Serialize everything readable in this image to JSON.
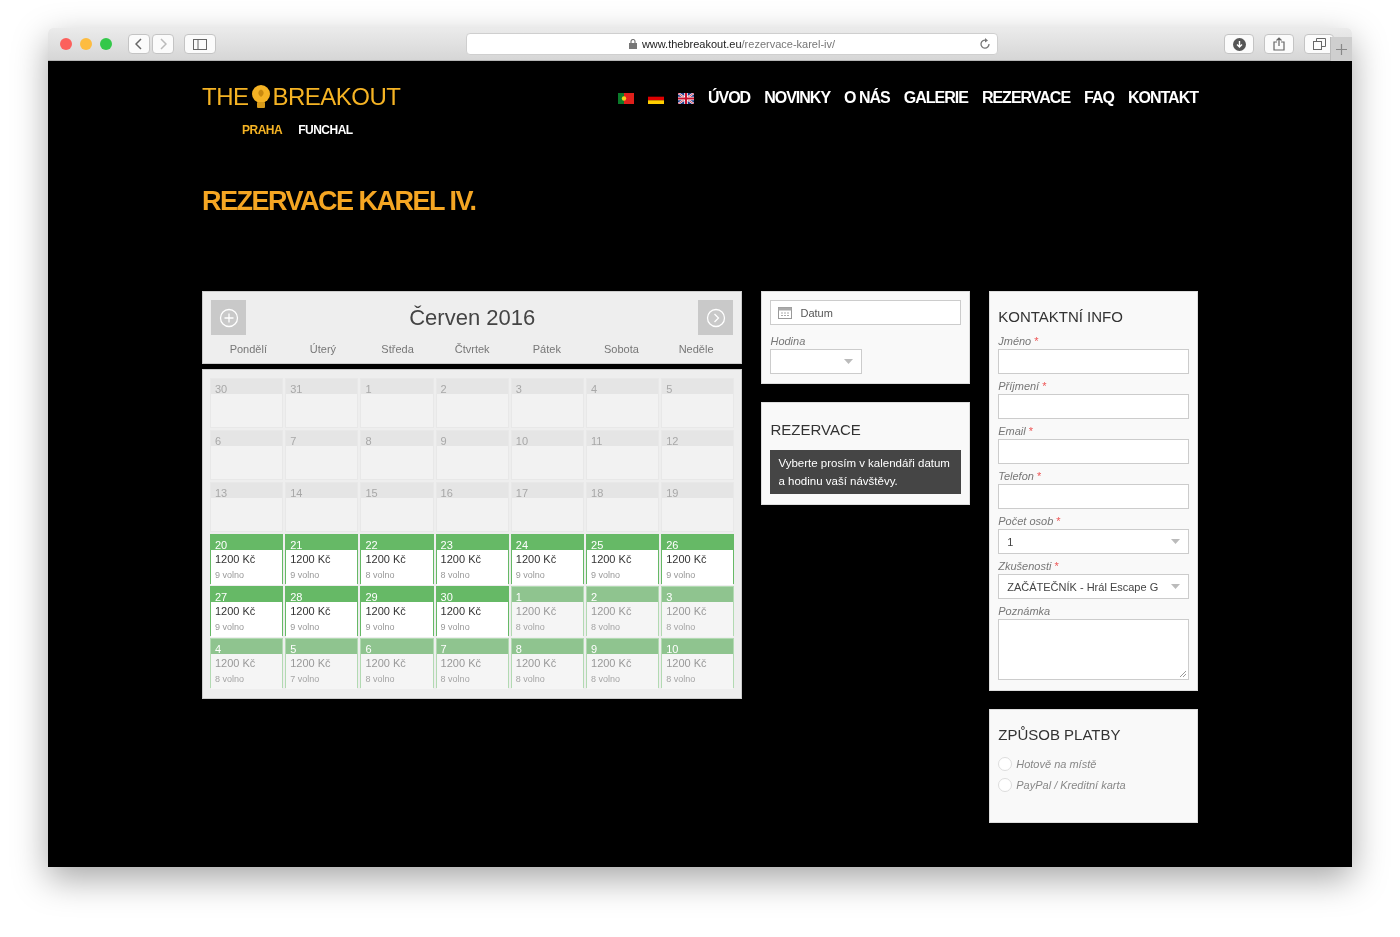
{
  "browser": {
    "url_domain": "www.thebreakout.eu",
    "url_path": "/rezervace-karel-iv/"
  },
  "logo": {
    "word_1": "THE",
    "word_2": "BREAKOUT"
  },
  "cities": [
    {
      "label": "PRAHA",
      "selected": true
    },
    {
      "label": "FUNCHAL",
      "selected": false
    }
  ],
  "nav": [
    "ÚVOD",
    "NOVINKY",
    "O NÁS",
    "GALERIE",
    "REZERVACE",
    "FAQ",
    "KONTAKT"
  ],
  "page_title": "REZERVACE KAREL IV.",
  "calendar": {
    "month": "Červen 2016",
    "weekdays": [
      "Pondělí",
      "Úterý",
      "Středa",
      "Čtvrtek",
      "Pátek",
      "Sobota",
      "Neděle"
    ],
    "weeks": [
      [
        {
          "day": "30",
          "kind": "past"
        },
        {
          "day": "31",
          "kind": "past"
        },
        {
          "day": "1",
          "kind": "past"
        },
        {
          "day": "2",
          "kind": "past"
        },
        {
          "day": "3",
          "kind": "past"
        },
        {
          "day": "4",
          "kind": "past"
        },
        {
          "day": "5",
          "kind": "past"
        }
      ],
      [
        {
          "day": "6",
          "kind": "past"
        },
        {
          "day": "7",
          "kind": "past"
        },
        {
          "day": "8",
          "kind": "past"
        },
        {
          "day": "9",
          "kind": "past"
        },
        {
          "day": "10",
          "kind": "past"
        },
        {
          "day": "11",
          "kind": "past"
        },
        {
          "day": "12",
          "kind": "past"
        }
      ],
      [
        {
          "day": "13",
          "kind": "past"
        },
        {
          "day": "14",
          "kind": "past"
        },
        {
          "day": "15",
          "kind": "past"
        },
        {
          "day": "16",
          "kind": "past"
        },
        {
          "day": "17",
          "kind": "past"
        },
        {
          "day": "18",
          "kind": "past"
        },
        {
          "day": "19",
          "kind": "past"
        }
      ],
      [
        {
          "day": "20",
          "kind": "open",
          "price": "1200 Kč",
          "free": "9 volno"
        },
        {
          "day": "21",
          "kind": "open",
          "price": "1200 Kč",
          "free": "9 volno"
        },
        {
          "day": "22",
          "kind": "open",
          "price": "1200 Kč",
          "free": "8 volno"
        },
        {
          "day": "23",
          "kind": "open",
          "price": "1200 Kč",
          "free": "8 volno"
        },
        {
          "day": "24",
          "kind": "open",
          "price": "1200 Kč",
          "free": "9 volno"
        },
        {
          "day": "25",
          "kind": "open",
          "price": "1200 Kč",
          "free": "9 volno"
        },
        {
          "day": "26",
          "kind": "open",
          "price": "1200 Kč",
          "free": "9 volno"
        }
      ],
      [
        {
          "day": "27",
          "kind": "open",
          "price": "1200 Kč",
          "free": "9 volno"
        },
        {
          "day": "28",
          "kind": "open",
          "price": "1200 Kč",
          "free": "9 volno"
        },
        {
          "day": "29",
          "kind": "open",
          "price": "1200 Kč",
          "free": "9 volno"
        },
        {
          "day": "30",
          "kind": "open",
          "price": "1200 Kč",
          "free": "9 volno"
        },
        {
          "day": "1",
          "kind": "next",
          "price": "1200 Kč",
          "free": "8 volno"
        },
        {
          "day": "2",
          "kind": "next",
          "price": "1200 Kč",
          "free": "8 volno"
        },
        {
          "day": "3",
          "kind": "next",
          "price": "1200 Kč",
          "free": "8 volno"
        }
      ],
      [
        {
          "day": "4",
          "kind": "next",
          "price": "1200 Kč",
          "free": "8 volno"
        },
        {
          "day": "5",
          "kind": "next",
          "price": "1200 Kč",
          "free": "7 volno"
        },
        {
          "day": "6",
          "kind": "next",
          "price": "1200 Kč",
          "free": "8 volno"
        },
        {
          "day": "7",
          "kind": "next",
          "price": "1200 Kč",
          "free": "8 volno"
        },
        {
          "day": "8",
          "kind": "next",
          "price": "1200 Kč",
          "free": "8 volno"
        },
        {
          "day": "9",
          "kind": "next",
          "price": "1200 Kč",
          "free": "8 volno"
        },
        {
          "day": "10",
          "kind": "next",
          "price": "1200 Kč",
          "free": "8 volno"
        }
      ]
    ]
  },
  "booking": {
    "date_placeholder": "Datum",
    "hour_label": "Hodina"
  },
  "reservation": {
    "title": "REZERVACE",
    "message": "Vyberte prosím v kalendáři datum a hodinu vaší návštěvy."
  },
  "required_mark": "*",
  "contact": {
    "title": "KONTAKTNÍ INFO",
    "fields": [
      {
        "label": "Jméno",
        "required": true,
        "kind": "text"
      },
      {
        "label": "Příjmení",
        "required": true,
        "kind": "text"
      },
      {
        "label": "Email",
        "required": true,
        "kind": "text"
      },
      {
        "label": "Telefon",
        "required": true,
        "kind": "text"
      },
      {
        "label": "Počet osob",
        "required": true,
        "kind": "select",
        "value": "1"
      },
      {
        "label": "Zkušenosti",
        "required": true,
        "kind": "select",
        "value": "ZAČÁTEČNÍK - Hrál Escape G"
      },
      {
        "label": "Poznámka",
        "required": false,
        "kind": "textarea"
      }
    ]
  },
  "payment": {
    "title": "ZPŮSOB PLATBY",
    "options": [
      {
        "label": "Hotově na místě",
        "selected": false
      },
      {
        "label": "PayPal / Kreditní karta",
        "selected": false
      }
    ]
  }
}
